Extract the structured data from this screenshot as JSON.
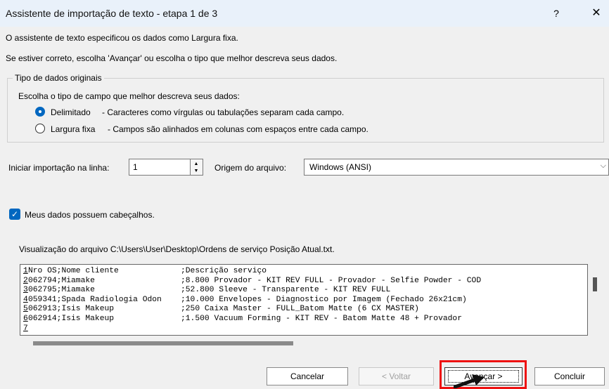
{
  "window": {
    "title": "Assistente de importação de texto - etapa 1 de 3",
    "help_label": "?",
    "close_label": "✕"
  },
  "intro": {
    "line1": "O assistente de texto especificou os dados como Largura fixa.",
    "line2": "Se estiver correto, escolha 'Avançar' ou escolha o tipo que melhor descreva seus dados."
  },
  "group": {
    "legend": "Tipo de dados originais",
    "prompt": "Escolha o tipo de campo que melhor descreva seus dados:",
    "options": [
      {
        "label": "Delimitado",
        "desc": "- Caracteres como vírgulas ou tabulações separam cada campo.",
        "checked": true
      },
      {
        "label": "Largura fixa",
        "desc": "- Campos são alinhados em colunas com espaços entre cada campo.",
        "checked": false
      }
    ]
  },
  "import": {
    "start_label": "Iniciar importação na linha:",
    "start_value": "1",
    "origin_label": "Origem do arquivo:",
    "origin_value": "Windows (ANSI)"
  },
  "headers_checkbox": {
    "label": "Meus dados possuem cabeçalhos.",
    "checked": true
  },
  "preview": {
    "caption": "Visualização do arquivo C:\\Users\\User\\Desktop\\Ordens de serviço Posição Atual.txt.",
    "rows": [
      {
        "n": "1",
        "a": "Nro OS;Nome cliente",
        "b": ";Descrição serviço"
      },
      {
        "n": "2",
        "a": "062794;Miamake",
        "b": ";8.800 Provador - KIT REV FULL - Provador - Selfie Powder - COD"
      },
      {
        "n": "3",
        "a": "062795;Miamake",
        "b": ";52.800 Sleeve - Transparente - KIT REV FULL"
      },
      {
        "n": "4",
        "a": "059341;Spada Radiologia Odon",
        "b": ";10.000 Envelopes - Diagnostico por Imagem (Fechado 26x21cm)"
      },
      {
        "n": "5",
        "a": "062913;Isis Makeup",
        "b": ";250 Caixa Master - FULL_Batom Matte (6 CX MASTER)"
      },
      {
        "n": "6",
        "a": "062914;Isis Makeup",
        "b": ";1.500 Vacuum Forming - KIT REV - Batom Matte 48 + Provador"
      },
      {
        "n": "7",
        "a": "",
        "b": ""
      }
    ]
  },
  "buttons": {
    "cancel": "Cancelar",
    "back": "< Voltar",
    "next": "Avançar >",
    "finish": "Concluir"
  },
  "colors": {
    "accent": "#0067c0",
    "highlight_box": "#ee1111"
  }
}
